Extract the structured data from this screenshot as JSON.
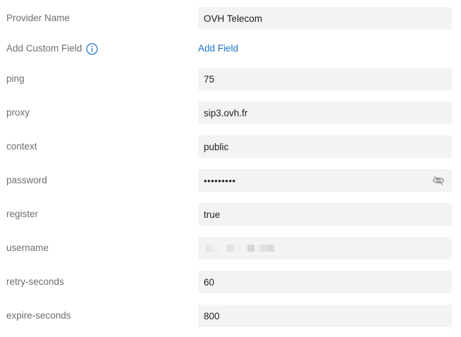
{
  "fields": {
    "provider_name": {
      "label": "Provider Name",
      "value": "OVH Telecom"
    },
    "custom_field": {
      "label": "Add Custom Field",
      "link": "Add Field",
      "icon": "info-icon"
    },
    "ping": {
      "label": "ping",
      "value": "75"
    },
    "proxy": {
      "label": "proxy",
      "value": "sip3.ovh.fr"
    },
    "context": {
      "label": "context",
      "value": "public"
    },
    "password": {
      "label": "password",
      "value": "•••••••••",
      "toggle_icon": "eye-slash-icon"
    },
    "register": {
      "label": "register",
      "value": "true"
    },
    "username": {
      "label": "username",
      "value_redacted": true
    },
    "retry_seconds": {
      "label": "retry-seconds",
      "value": "60"
    },
    "expire_seconds": {
      "label": "expire-seconds",
      "value": "800"
    }
  },
  "colors": {
    "label": "#6e6e6e",
    "link": "#1a73c9",
    "field_bg": "#f3f3f3",
    "text": "#1f1f1f"
  }
}
